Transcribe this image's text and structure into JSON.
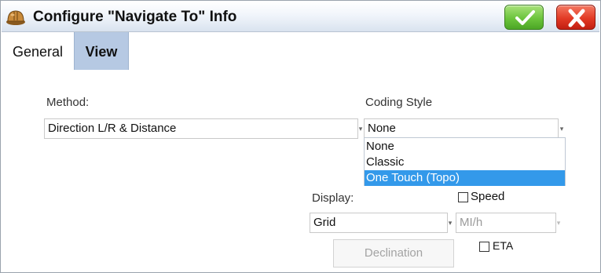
{
  "window": {
    "title": "Configure \"Navigate To\" Info",
    "icons": {
      "app": "hard-hat-icon",
      "ok": "checkmark-icon",
      "cancel": "close-icon"
    },
    "colors": {
      "ok": "#5cb832",
      "cancel": "#e0301e",
      "active_tab": "#b6c9e3",
      "selection": "#3399ea"
    }
  },
  "tabs": [
    {
      "label": "General",
      "active": false
    },
    {
      "label": "View",
      "active": true
    }
  ],
  "method": {
    "label": "Method:",
    "value": "Direction L/R & Distance"
  },
  "coding_style": {
    "label": "Coding Style",
    "value": "None",
    "options": [
      "None",
      "Classic",
      "One Touch (Topo)"
    ],
    "highlighted": "One Touch (Topo)"
  },
  "display": {
    "label": "Display:",
    "value": "Grid"
  },
  "speed": {
    "label": "Speed",
    "checked": false,
    "unit": "MI/h"
  },
  "declination": {
    "label": "Declination",
    "enabled": false
  },
  "eta": {
    "label": "ETA",
    "checked": false
  }
}
